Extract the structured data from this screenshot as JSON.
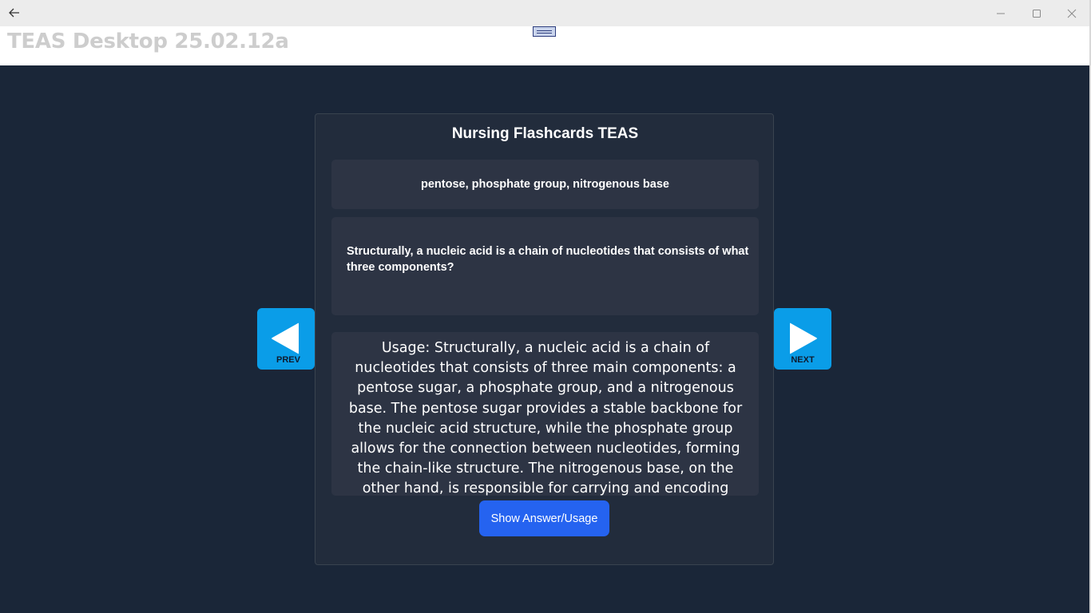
{
  "window": {
    "back_icon": "arrow-left-icon",
    "minimize_icon": "minimize-icon",
    "maximize_icon": "maximize-icon",
    "close_icon": "close-icon"
  },
  "app": {
    "title": "TEAS Desktop 25.02.12a"
  },
  "card": {
    "title": "Nursing Flashcards TEAS",
    "answer": "pentose, phosphate group, nitrogenous base",
    "question": "Structurally, a nucleic acid is a chain of nucleotides that consists of what three components?",
    "usage": "Usage: Structurally, a nucleic acid is a chain of nucleotides that consists of three main components: a pentose sugar, a phosphate group, and a nitrogenous base. The pentose sugar provides a stable backbone for the nucleic acid structure, while the phosphate group allows for the connection between nucleotides, forming the chain-like structure. The nitrogenous base, on the other hand, is responsible for carrying and encoding genetic information.",
    "show_button": "Show Answer/Usage"
  },
  "nav": {
    "prev_label": "PREV",
    "next_label": "NEXT",
    "button_color": "#0a9de8"
  },
  "colors": {
    "background": "#1a2638",
    "card": "#222c3c",
    "box": "#2d3444",
    "accent": "#2563f0"
  }
}
